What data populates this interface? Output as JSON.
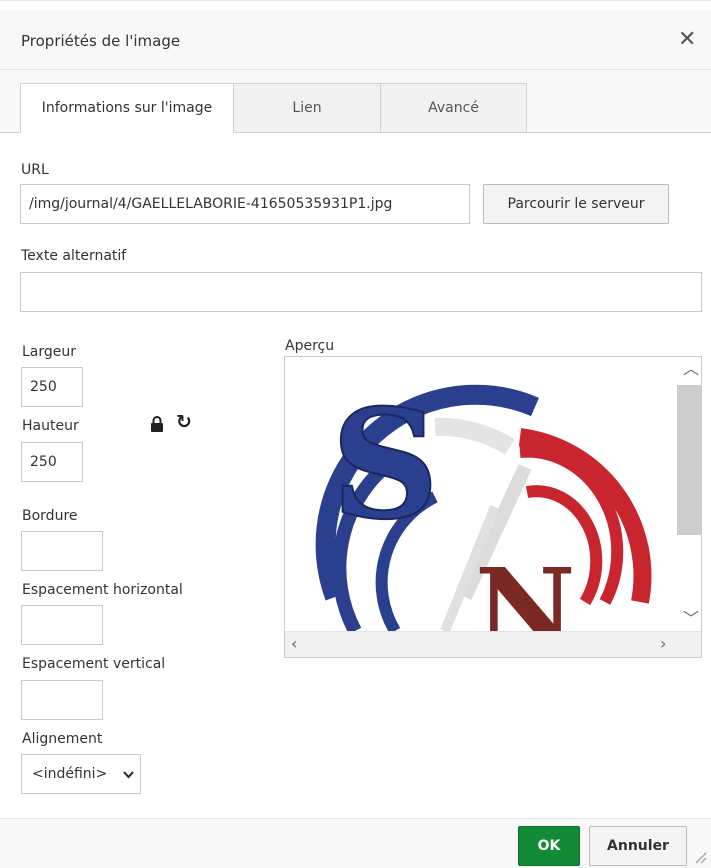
{
  "dialog": {
    "title": "Propriétés de l'image",
    "close_icon": "close-icon"
  },
  "tabs": [
    {
      "label": "Informations sur l'image",
      "active": true
    },
    {
      "label": "Lien",
      "active": false
    },
    {
      "label": "Avancé",
      "active": false
    }
  ],
  "url": {
    "label": "URL",
    "value": "/img/journal/4/GAELLELABORIE-41650535931P1.jpg",
    "browse_label": "Parcourir le serveur"
  },
  "alt_text": {
    "label": "Texte alternatif",
    "value": ""
  },
  "dimensions": {
    "width_label": "Largeur",
    "width_value": "250",
    "height_label": "Hauteur",
    "height_value": "250",
    "lock_icon": "lock-icon",
    "reset_icon": "reset-size-icon"
  },
  "border": {
    "label": "Bordure",
    "value": ""
  },
  "hspace": {
    "label": "Espacement horizontal",
    "value": ""
  },
  "vspace": {
    "label": "Espacement vertical",
    "value": ""
  },
  "alignment": {
    "label": "Alignement",
    "selected": "<indéfini>"
  },
  "preview": {
    "label": "Aperçu",
    "colors": {
      "blue": "#2b3f8f",
      "red": "#c8252e",
      "white": "#f2f2f2",
      "brown": "#7a2a22"
    }
  },
  "footer": {
    "ok_label": "OK",
    "cancel_label": "Annuler",
    "ok_color": "#138a36"
  }
}
